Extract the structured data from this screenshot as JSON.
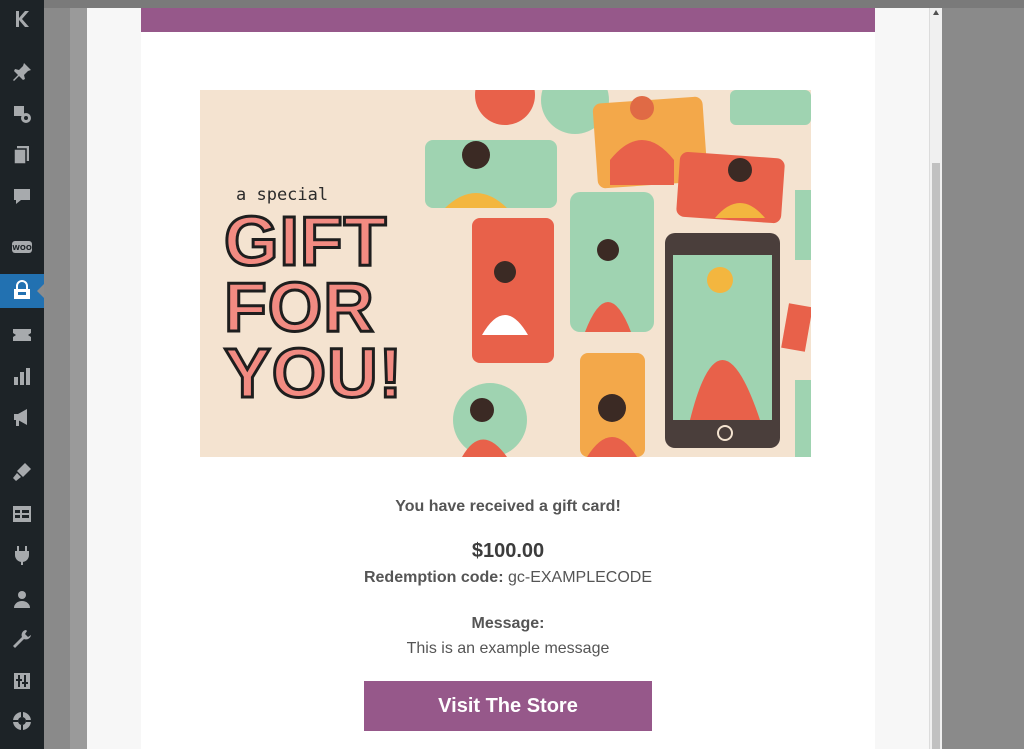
{
  "sidebar": {
    "icons": [
      "logo-k-icon",
      "pin-icon",
      "media-icon",
      "pages-icon",
      "comments-icon",
      "woo-icon",
      "store-icon",
      "products-icon",
      "analytics-icon",
      "marketing-icon",
      "appearance-icon",
      "templates-icon",
      "plugins-icon",
      "users-icon",
      "tools-icon",
      "settings-icon",
      "help-icon"
    ],
    "active": "store-icon",
    "accent": "#2271b1"
  },
  "email": {
    "header_color": "#96588a",
    "banner": {
      "tagline": "a special",
      "headline_lines": [
        "GIFT",
        "FOR",
        "YOU!"
      ]
    },
    "received_text": "You have received a gift card!",
    "amount": "$100.00",
    "code_label": "Redemption code:",
    "code_value": "gc-EXAMPLECODE",
    "message_label": "Message:",
    "message_text": "This is an example message",
    "button_label": "Visit The Store",
    "button_color": "#96588a"
  }
}
